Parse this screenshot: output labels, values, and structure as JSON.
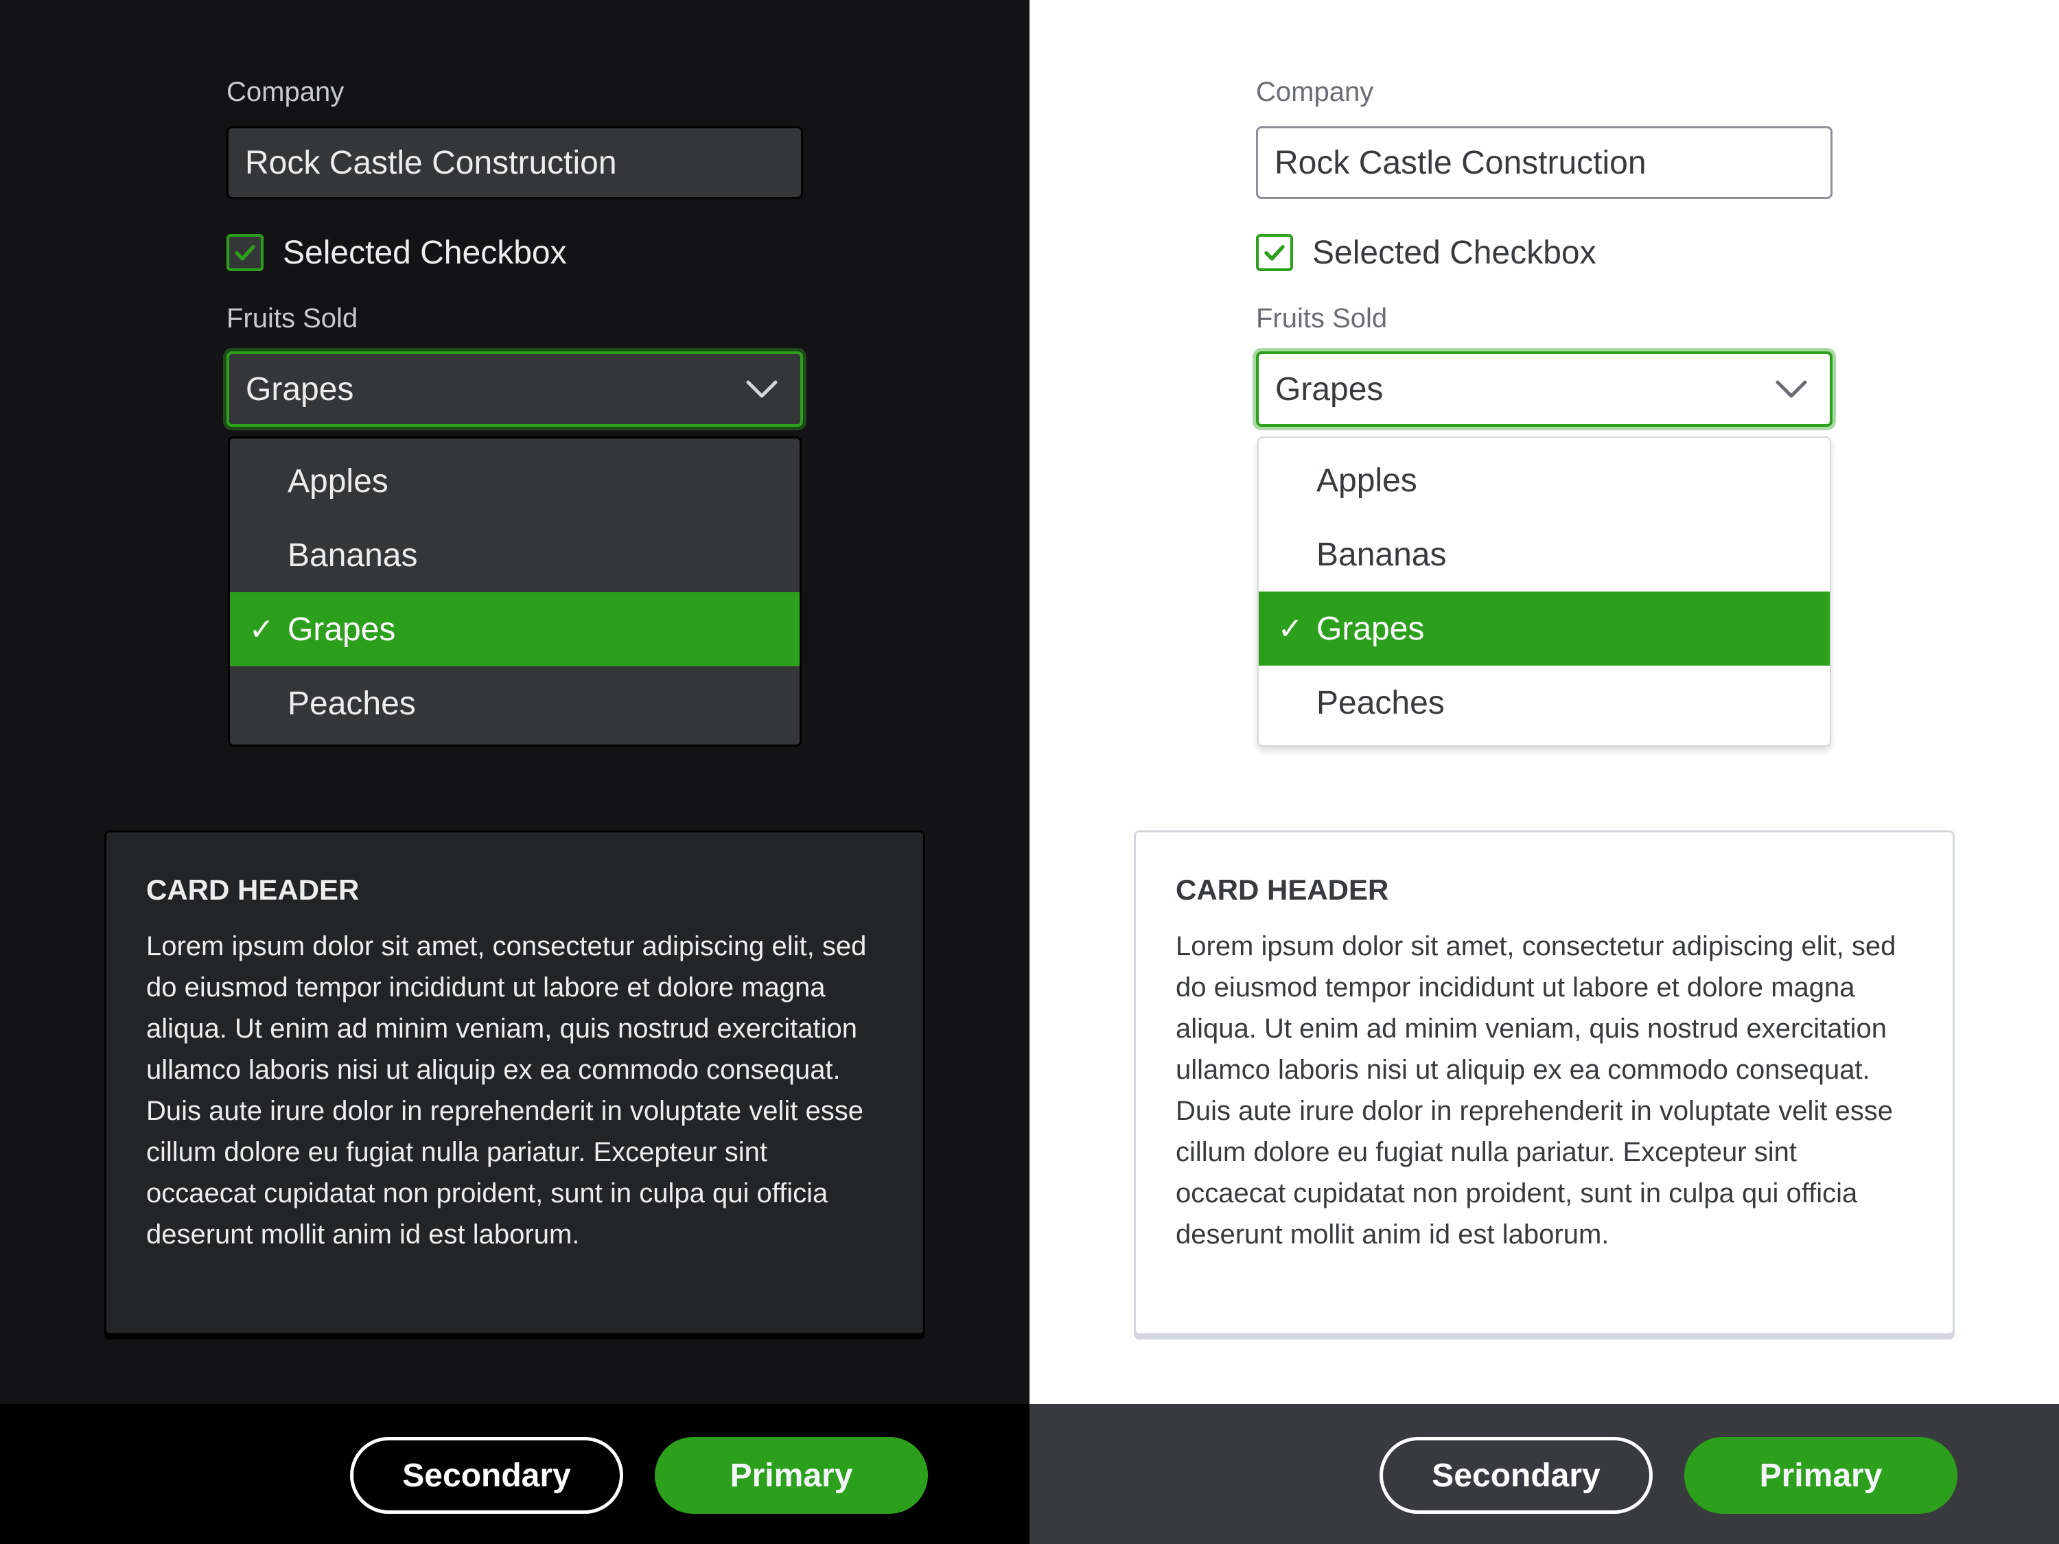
{
  "colors": {
    "accent": "#2ca01c",
    "dark_bg": "#131315",
    "dark_surface": "#353638",
    "dark_card": "#232426",
    "light_bg": "#ffffff",
    "light_text": "#393a3d",
    "light_footer": "#393a3d"
  },
  "themes": [
    {
      "name": "dark",
      "company_label": "Company",
      "company_value": "Rock Castle Construction",
      "checkbox_label": "Selected Checkbox",
      "checkbox_checked": true,
      "fruits_label": "Fruits Sold",
      "fruits_selected": "Grapes",
      "fruits_options": [
        {
          "label": "Apples",
          "selected": false
        },
        {
          "label": "Bananas",
          "selected": false
        },
        {
          "label": "Grapes",
          "selected": true
        },
        {
          "label": "Peaches",
          "selected": false
        }
      ],
      "card_header": "CARD HEADER",
      "card_body": "Lorem ipsum dolor sit amet, consectetur adipiscing elit, sed do eiusmod tempor incididunt ut labore et dolore magna aliqua. Ut enim ad minim veniam, quis nostrud exercitation ullamco laboris nisi ut aliquip ex ea commodo consequat. Duis aute irure dolor in reprehenderit in voluptate velit esse cillum dolore eu fugiat nulla pariatur. Excepteur sint occaecat cupidatat non proident, sunt in culpa qui officia deserunt mollit anim id est laborum.",
      "secondary_button": "Secondary",
      "primary_button": "Primary"
    },
    {
      "name": "light",
      "company_label": "Company",
      "company_value": "Rock Castle Construction",
      "checkbox_label": "Selected Checkbox",
      "checkbox_checked": true,
      "fruits_label": "Fruits Sold",
      "fruits_selected": "Grapes",
      "fruits_options": [
        {
          "label": "Apples",
          "selected": false
        },
        {
          "label": "Bananas",
          "selected": false
        },
        {
          "label": "Grapes",
          "selected": true
        },
        {
          "label": "Peaches",
          "selected": false
        }
      ],
      "card_header": "CARD HEADER",
      "card_body": "Lorem ipsum dolor sit amet, consectetur adipiscing elit, sed do eiusmod tempor incididunt ut labore et dolore magna aliqua. Ut enim ad minim veniam, quis nostrud exercitation ullamco laboris nisi ut aliquip ex ea commodo consequat. Duis aute irure dolor in reprehenderit in voluptate velit esse cillum dolore eu fugiat nulla pariatur. Excepteur sint occaecat cupidatat non proident, sunt in culpa qui officia deserunt mollit anim id est laborum.",
      "secondary_button": "Secondary",
      "primary_button": "Primary"
    }
  ],
  "icons": {
    "checkmark": "✓",
    "chevron": "chevron-down-icon"
  }
}
